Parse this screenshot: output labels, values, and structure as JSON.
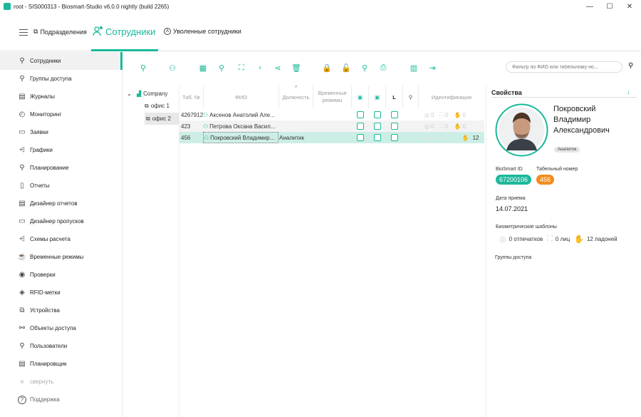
{
  "window": {
    "title": "root - SIS000313 - Biosmart-Studio v6.0.0 nightly (build 2265)"
  },
  "tabs": {
    "subdivisions": "Подразделения",
    "employees": "Сотрудники",
    "fired": "Уволенные сотрудники"
  },
  "sidebar": {
    "items": [
      {
        "label": "Сотрудники",
        "icon": "person-icon"
      },
      {
        "label": "Группы доступа",
        "icon": "group-icon"
      },
      {
        "label": "Журналы",
        "icon": "journal-icon"
      },
      {
        "label": "Мониторинг",
        "icon": "gauge-icon"
      },
      {
        "label": "Заявки",
        "icon": "request-icon"
      },
      {
        "label": "Графики",
        "icon": "schedule-icon"
      },
      {
        "label": "Планирование",
        "icon": "planning-icon"
      },
      {
        "label": "Отчеты",
        "icon": "report-icon"
      },
      {
        "label": "Дизайнер отчетов",
        "icon": "report-designer-icon"
      },
      {
        "label": "Дизайнер пропусков",
        "icon": "pass-designer-icon"
      },
      {
        "label": "Схемы расчета",
        "icon": "calc-scheme-icon"
      },
      {
        "label": "Временные режимы",
        "icon": "time-mode-icon"
      },
      {
        "label": "Проверки",
        "icon": "eye-icon"
      },
      {
        "label": "RFID-метки",
        "icon": "rfid-icon"
      },
      {
        "label": "Устройства",
        "icon": "devices-icon"
      },
      {
        "label": "Объекты доступа",
        "icon": "access-objects-icon"
      },
      {
        "label": "Пользователи",
        "icon": "users-icon"
      },
      {
        "label": "Планировщик",
        "icon": "scheduler-icon"
      }
    ],
    "collapse": "свернуть",
    "support": "Поддержка"
  },
  "filter": {
    "placeholder": "Фильтр по ФИО или табельному но..."
  },
  "tree": {
    "root": "Company",
    "children": [
      "офис 1",
      "офис 2"
    ]
  },
  "grid": {
    "headers": {
      "tab": "Таб. №",
      "fio": "ФИО",
      "position": "Должность",
      "time_modes": "Временные режимы",
      "l": "L",
      "identification": "Идентификация"
    },
    "rows": [
      {
        "tab": "4267912",
        "fio": "Аксенов Анатолий Але...",
        "position": "",
        "fp": "0",
        "face": "0",
        "palm": "0"
      },
      {
        "tab": "423",
        "fio": "Петрова Оксана Васил...",
        "position": "",
        "fp": "0",
        "face": "0",
        "palm": "0"
      },
      {
        "tab": "456",
        "fio": "Покровский Владимир...",
        "position": "Аналитик",
        "fp": "",
        "face": "",
        "palm": "12"
      }
    ]
  },
  "props": {
    "title": "Свойства",
    "name_line1": "Покровский",
    "name_line2": "Владимир",
    "name_line3": "Александрович",
    "role": "Аналитик",
    "biosmart_id_label": "BioSmart ID",
    "biosmart_id": "67200106",
    "tab_label": "Табельный номер",
    "tab": "456",
    "hire_label": "Дата приема",
    "hire_date": "14.07.2021",
    "bio_label": "Биометрические шаблоны",
    "fp_count": "0 отпечатков",
    "face_count": "0 лиц",
    "palm_count": "12 ладоней",
    "groups_label": "Группы доступа"
  },
  "colors": {
    "accent": "#1cb89a",
    "orange": "#f28c1e",
    "selected_row": "#cdeee6"
  }
}
